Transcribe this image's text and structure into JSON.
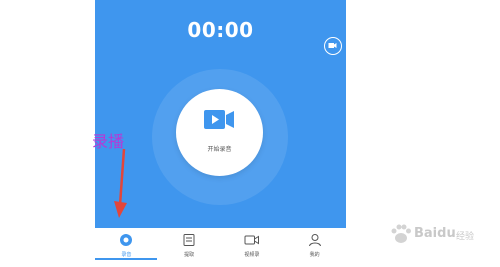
{
  "recorder": {
    "timer": "00:00",
    "record_button_label": "开始录音",
    "accent_color": "#3f96ee"
  },
  "tabs": [
    {
      "label": "录音",
      "icon": "record-circle-icon",
      "active": true
    },
    {
      "label": "提取",
      "icon": "extract-icon",
      "active": false
    },
    {
      "label": "视频录",
      "icon": "video-record-icon",
      "active": false
    },
    {
      "label": "我的",
      "icon": "user-icon",
      "active": false
    }
  ],
  "annotation": {
    "text": "录播",
    "color": "#b53ad6",
    "arrow_color": "#e2463b"
  },
  "watermark": {
    "brand": "Baidu",
    "sub": "经验"
  }
}
